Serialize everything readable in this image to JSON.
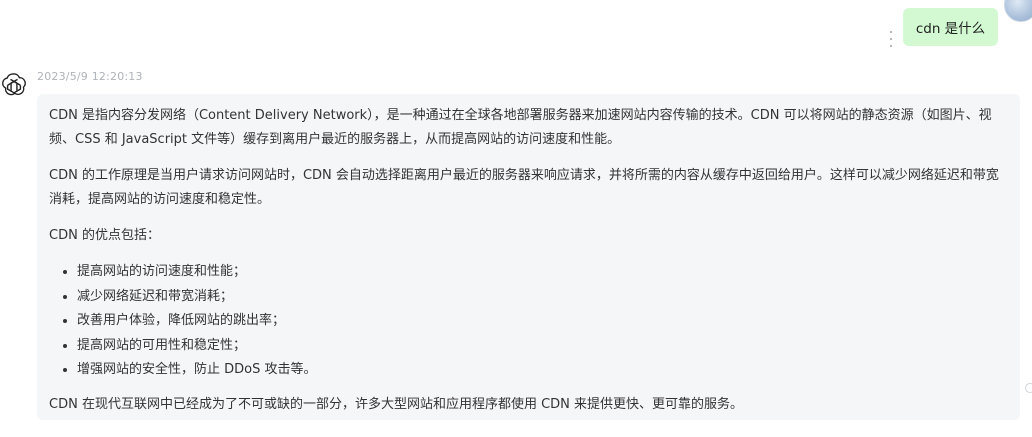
{
  "user_message": {
    "text": "cdn 是什么"
  },
  "bot_message": {
    "timestamp": "2023/5/9 12:20:13",
    "paragraphs": [
      "CDN 是指内容分发网络（Content Delivery Network），是一种通过在全球各地部署服务器来加速网站内容传输的技术。CDN 可以将网站的静态资源（如图片、视频、CSS 和 JavaScript 文件等）缓存到离用户最近的服务器上，从而提高网站的访问速度和性能。",
      "CDN 的工作原理是当用户请求访问网站时，CDN 会自动选择距离用户最近的服务器来响应请求，并将所需的内容从缓存中返回给用户。这样可以减少网络延迟和带宽消耗，提高网站的访问速度和稳定性。",
      "CDN 的优点包括："
    ],
    "list_items": [
      "提高网站的访问速度和性能；",
      "减少网络延迟和带宽消耗；",
      "改善用户体验，降低网站的跳出率；",
      "提高网站的可用性和稳定性；",
      "增强网站的安全性，防止 DDoS 攻击等。"
    ],
    "conclusion": "CDN 在现代互联网中已经成为了不可或缺的一部分，许多大型网站和应用程序都使用 CDN 来提供更快、更可靠的服务。"
  },
  "icons": {
    "bot_avatar": "openai-logo-icon",
    "user_avatar": "user-avatar",
    "user_more": "more-vertical-icon"
  },
  "colors": {
    "user_bubble": "#d2f9d1",
    "bot_bubble": "#f4f6f8",
    "timestamp": "#b0b3b8"
  }
}
